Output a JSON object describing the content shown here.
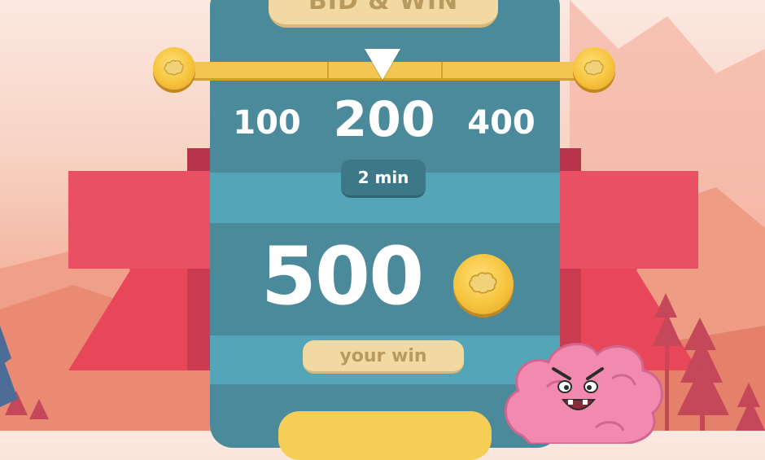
{
  "header": {
    "title": "BID & WIN"
  },
  "bid": {
    "options": [
      "100",
      "200",
      "400"
    ],
    "selected": "200",
    "selected_index": 1,
    "duration": "2 min"
  },
  "prize": {
    "amount": "500",
    "label": "your win"
  },
  "icons": {
    "currency": "brain-coin-icon",
    "slider_thumb": "triangle-pointer-icon",
    "character": "angry-pink-brain-character"
  },
  "colors": {
    "card": "#4b8a9a",
    "card_band": "#55a5b8",
    "ribbon": "#e8475a",
    "coin": "#f6c43d",
    "pill": "#f2d9a1",
    "character": "#f28ab0"
  }
}
